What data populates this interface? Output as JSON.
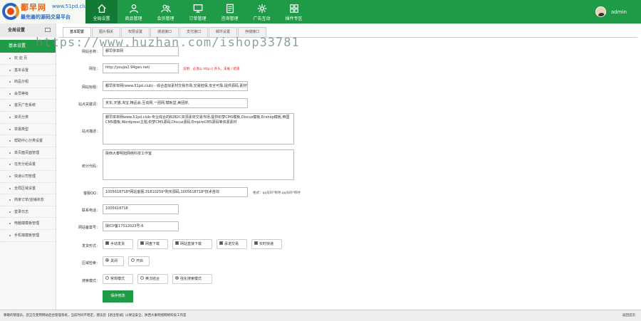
{
  "logo": {
    "text_main": "鄱早网",
    "text_url": "www.51pd.club",
    "text_sub": "最完善的源码交易平台"
  },
  "nav": [
    {
      "label": "全局设置",
      "icon": "home-icon"
    },
    {
      "label": "商品管理",
      "icon": "user-icon"
    },
    {
      "label": "会员管理",
      "icon": "users-icon"
    },
    {
      "label": "订单管理",
      "icon": "monitor-icon"
    },
    {
      "label": "咨询管理",
      "icon": "document-icon"
    },
    {
      "label": "广告互动",
      "icon": "gear-icon"
    },
    {
      "label": "插件专区",
      "icon": "grid-icon"
    }
  ],
  "user": {
    "name": "admin"
  },
  "sidebar": {
    "header": "全局设置",
    "section": "基本设置",
    "items": [
      "欢 迎 页",
      "基本设置",
      "商品分组",
      "会员等级",
      "首页广告系统",
      "资讯分类",
      "举报类型",
      "帮助中心分类设置",
      "单页面页面管理",
      "任务分组设置",
      "快递公司管理",
      "全局区域设置",
      "商家订单/店铺状态",
      "登录日志",
      "电脑端模板管理",
      "手机端模板管理"
    ]
  },
  "tabs": [
    "基本配置",
    "图片相关",
    "权限设置",
    "通道接口",
    "支付接口",
    "邮件设置",
    "存储接口"
  ],
  "form": {
    "site_name": {
      "label": "网站名称：",
      "value": "鄱早拼单网"
    },
    "site_url": {
      "label": "网址：",
      "value": "http://youjia2.94gan.net/",
      "hint": "说明：必须以 http:// 开头，末尾 / 结束"
    },
    "site_title": {
      "label": "网站标题：",
      "value": "鄱早拼单网(www.51pd.club) - 综合虚拟素材交易市场,交易担保,安全可靠,提供源码,素材等交易"
    },
    "keywords": {
      "label": "站点关键词：",
      "value": "京东,天猫,淘宝,精品会,互动网,一团网,模板堂,美团拼,"
    },
    "description": {
      "label": "站点描述：",
      "value": "鄱早拼单网www.51pd.club-专业综合的B2B2C资源素材交易市场,提供织梦CMS模板,Discuz模板,Ecshop模板,帝国CMS模板,Wordpress主题,织梦CMS源码,Discuz源码,EmpireCMS源码等资源素材"
    },
    "stats": {
      "label": "统计代码：",
      "value": "陕西大秦明旭网络科技工作室"
    },
    "qq": {
      "label": "客服QQ：",
      "value": "1005618718*网站客服,31810259*购买源码,1005618718*技术咨询",
      "hint": "格式：qq号码*称呼,qq号码*称呼"
    },
    "phone": {
      "label": "联系电话：",
      "value": "1005618718"
    },
    "icp": {
      "label": "网站备案号：",
      "value": "陕ICP备17012023号-6"
    },
    "shipping": {
      "label": "发货形式：",
      "options": [
        {
          "text": "手动发货",
          "checked": true
        },
        {
          "text": "网盘下载",
          "checked": true
        },
        {
          "text": "网站直接下载",
          "checked": true
        },
        {
          "text": "承诺交易",
          "checked": true
        },
        {
          "text": "实时快递",
          "checked": true
        }
      ]
    },
    "region": {
      "label": "区域检索：",
      "options": [
        {
          "text": "关闭",
          "checked": true
        },
        {
          "text": "开启",
          "checked": false
        }
      ]
    },
    "search": {
      "label": "搜索模式：",
      "options": [
        {
          "text": "常规模式",
          "checked": false
        },
        {
          "text": "英汉结合",
          "checked": false
        },
        {
          "text": "强化搜索模式",
          "checked": true
        }
      ]
    },
    "save_label": "保存修改"
  },
  "watermark": "https://www.huzhan.com/ishop33781",
  "footer": {
    "text": "尊敬的管理员，您正在使用网站后台管理系统，当前时间不稳定，建议您【退出登录】以保证安全，陕西大秦明旭网络科技工作室",
    "right": "返回首页"
  }
}
